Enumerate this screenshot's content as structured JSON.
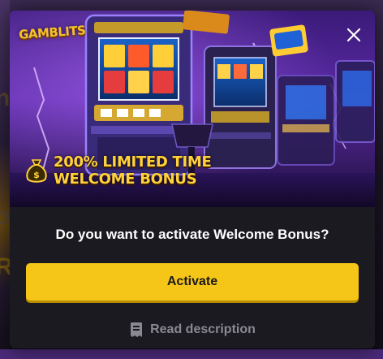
{
  "colors": {
    "modal_bg": "#1c1a21",
    "accent_yellow": "#f5c518",
    "promo_text": "#ffd23a",
    "muted_text": "#8a8890",
    "banner_purple": "#5b2aa6"
  },
  "banner": {
    "brand_logo_text": "GAMBLITS",
    "promo_line_1": "200% LIMITED TIME",
    "promo_line_2": "WELCOME BONUS",
    "promo_icon": "money-bag-icon",
    "close_icon": "close-icon"
  },
  "dialog": {
    "question": "Do you want to activate Welcome Bonus?",
    "activate_label": "Activate",
    "read_description_label": "Read description",
    "read_description_icon": "document-icon"
  }
}
